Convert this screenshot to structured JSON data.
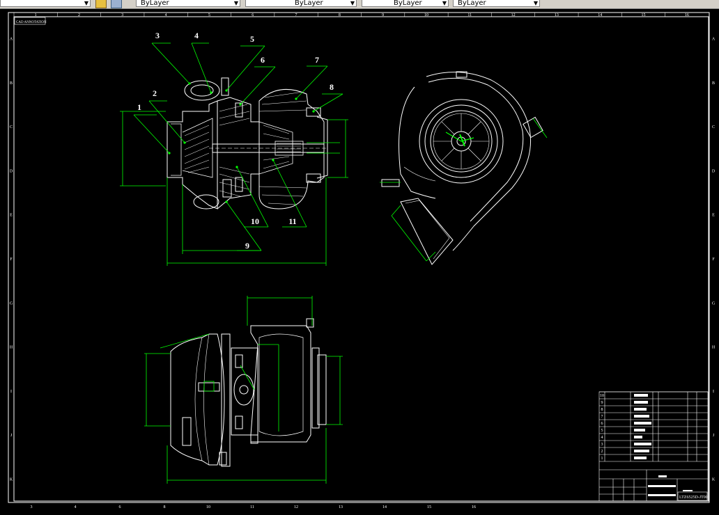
{
  "toolbar": {
    "layer_combo": "ByLayer",
    "color_combo": "ByLayer",
    "linetype_combo": "ByLayer",
    "lineweight_combo": "ByLayer"
  },
  "drawing": {
    "corner_label": "CAD ANNOTATION",
    "column_numbers": [
      "1",
      "2",
      "3",
      "4",
      "5",
      "6",
      "7",
      "8",
      "9",
      "10",
      "11",
      "12",
      "13",
      "14",
      "15",
      "16"
    ],
    "bottom_column_numbers": [
      "3",
      "4",
      "6",
      "8",
      "10",
      "11",
      "12",
      "13",
      "14",
      "15",
      "16"
    ],
    "row_letters": [
      "A",
      "B",
      "C",
      "D",
      "E",
      "F",
      "G",
      "H",
      "I",
      "J",
      "K"
    ],
    "part_balloons": [
      "1",
      "2",
      "3",
      "4",
      "5",
      "6",
      "7",
      "8",
      "9",
      "10",
      "11"
    ],
    "title_block": {
      "drawing_number": "LTZ6525D-JT00",
      "row_numbers": [
        "10",
        "9",
        "8",
        "7",
        "6",
        "5",
        "4",
        "3",
        "2",
        "1"
      ]
    }
  },
  "colors": {
    "background": "#000000",
    "geometry": "#ffffff",
    "dimension": "#00ff00",
    "toolbar": "#d4d0c8"
  }
}
